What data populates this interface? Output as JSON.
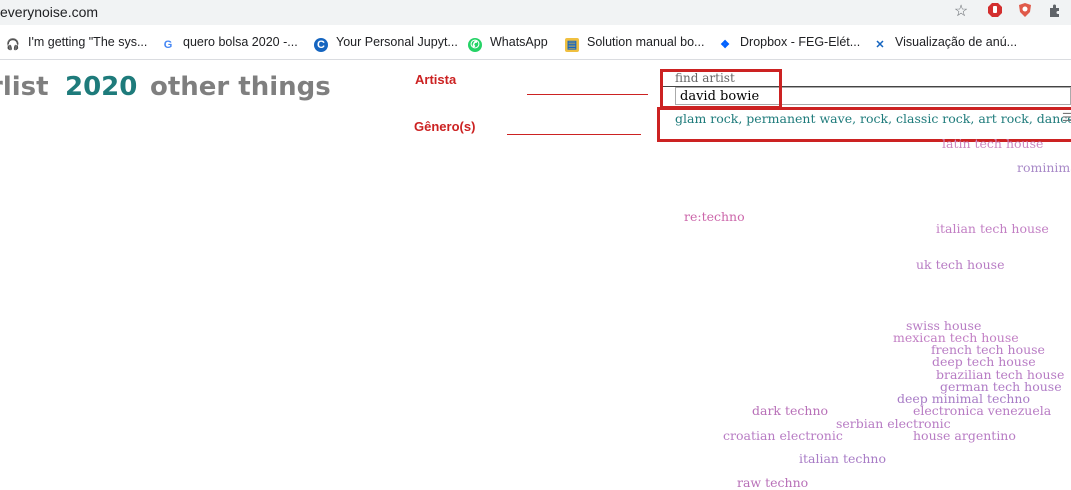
{
  "browser": {
    "url": "everynoise.com",
    "bookmarks": [
      {
        "label": "I'm getting \"The sys...",
        "icon": "headphones-icon"
      },
      {
        "label": "quero bolsa 2020 -...",
        "icon": "google-icon"
      },
      {
        "label": "Your Personal Jupyt...",
        "icon": "cocalc-icon"
      },
      {
        "label": "WhatsApp",
        "icon": "whatsapp-icon"
      },
      {
        "label": "Solution manual bo...",
        "icon": "document-icon"
      },
      {
        "label": "Dropbox - FEG-Elét...",
        "icon": "dropbox-icon"
      },
      {
        "label": "Visualização de anú...",
        "icon": "x-icon"
      }
    ]
  },
  "nav": {
    "items": [
      "rlist",
      "2020",
      "other things"
    ]
  },
  "annotations": {
    "artist_label": "Artista",
    "genre_label": "Gênero(s)"
  },
  "search": {
    "label": "find artist",
    "value": "david bowie"
  },
  "artist_genres": "glam rock, permanent wave, rock, classic rock, art rock, dance rock",
  "genre_menu_glyph": "☰",
  "colors": {
    "accent": "#1e7b7b",
    "annotation": "#cc2222",
    "genre_purple": "#b07cc6",
    "genre_pink": "#cc66aa"
  },
  "genre_cloud": [
    {
      "label": "latin tech house"
    },
    {
      "label": "rominimal"
    },
    {
      "label": "re:techno"
    },
    {
      "label": "italian tech house"
    },
    {
      "label": "uk tech house"
    },
    {
      "label": "swiss house"
    },
    {
      "label": "mexican tech house"
    },
    {
      "label": "french tech house"
    },
    {
      "label": "deep tech house"
    },
    {
      "label": "brazilian tech house"
    },
    {
      "label": "german tech house"
    },
    {
      "label": "deep minimal techno"
    },
    {
      "label": "electronica venezuela"
    },
    {
      "label": "dark techno"
    },
    {
      "label": "serbian electronic"
    },
    {
      "label": "croatian electronic"
    },
    {
      "label": "house argentino"
    },
    {
      "label": "italian techno"
    },
    {
      "label": "raw techno"
    }
  ]
}
